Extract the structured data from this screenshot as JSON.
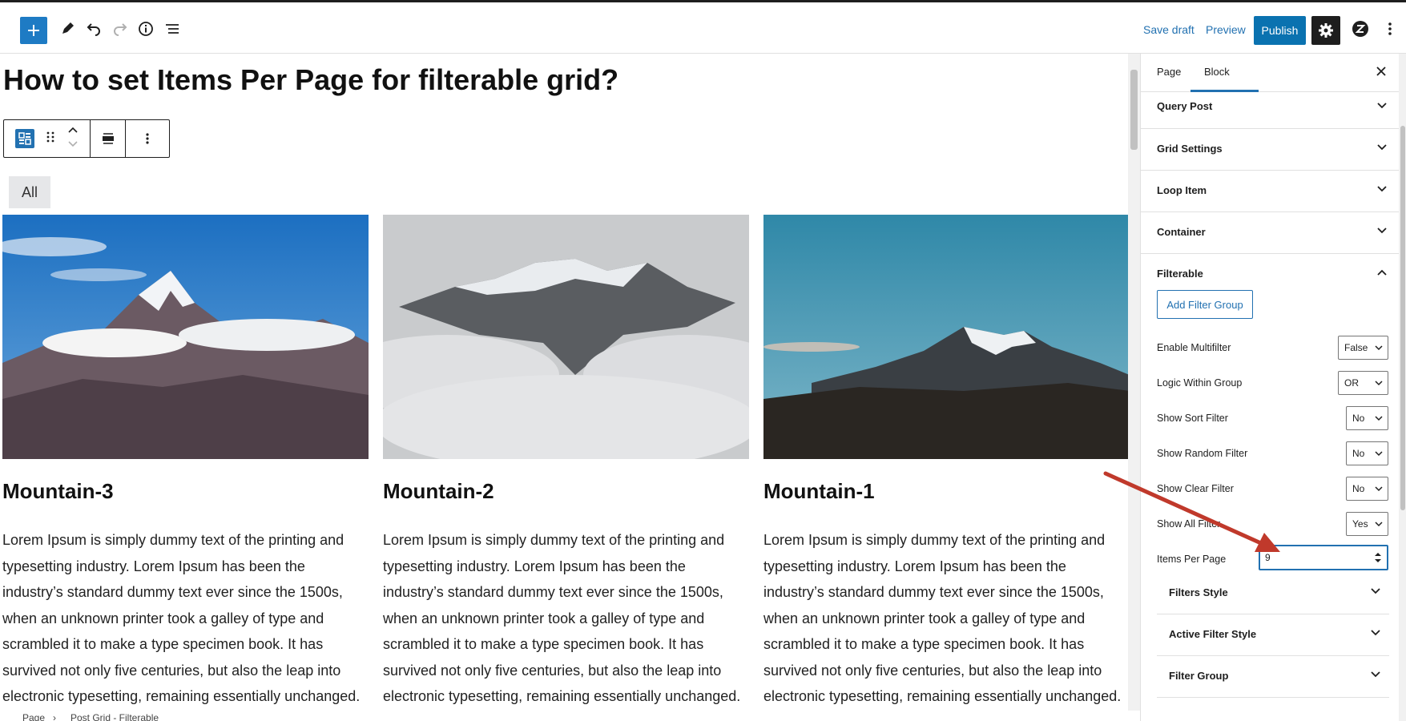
{
  "toolbar": {
    "save_draft": "Save draft",
    "preview": "Preview",
    "publish": "Publish"
  },
  "editor": {
    "title": "How to set Items Per Page for filterable grid?",
    "filter_all": "All",
    "posts": [
      {
        "title": "Mountain-3",
        "excerpt": "Lorem Ipsum is simply dummy text of the printing and typesetting industry. Lorem Ipsum has been the industry’s standard dummy text ever since the 1500s, when an unknown printer took a galley of type and scrambled it to make a type specimen book. It has survived not only five centuries, but also the leap into electronic typesetting, remaining essentially unchanged."
      },
      {
        "title": "Mountain-2",
        "excerpt": "Lorem Ipsum is simply dummy text of the printing and typesetting industry. Lorem Ipsum has been the industry’s standard dummy text ever since the 1500s, when an unknown printer took a galley of type and scrambled it to make a type specimen book. It has survived not only five centuries, but also the leap into electronic typesetting, remaining essentially unchanged."
      },
      {
        "title": "Mountain-1",
        "excerpt": "Lorem Ipsum is simply dummy text of the printing and typesetting industry. Lorem Ipsum has been the industry’s standard dummy text ever since the 1500s, when an unknown printer took a galley of type and scrambled it to make a type specimen book. It has survived not only five centuries, but also the leap into electronic typesetting, remaining essentially unchanged."
      }
    ]
  },
  "breadcrumb": {
    "root": "Page",
    "separator": "›",
    "current": "Post Grid - Filterable"
  },
  "sidebar": {
    "tabs": [
      "Page",
      "Block"
    ],
    "panels": [
      "Query Post",
      "Grid Settings",
      "Loop Item",
      "Container",
      "Filterable"
    ],
    "filterable": {
      "add_filter_group": "Add Filter Group",
      "settings": [
        {
          "label": "Enable Multifilter",
          "value": "False"
        },
        {
          "label": "Logic Within Group",
          "value": "OR"
        },
        {
          "label": "Show Sort Filter",
          "value": "No"
        },
        {
          "label": "Show Random Filter",
          "value": "No"
        },
        {
          "label": "Show Clear Filter",
          "value": "No"
        },
        {
          "label": "Show All Filter",
          "value": "Yes"
        }
      ],
      "items_per_page": {
        "label": "Items Per Page",
        "value": "9"
      },
      "subpanels": [
        "Filters Style",
        "Active Filter Style",
        "Filter Group"
      ]
    }
  },
  "colors": {
    "accent": "#2271b1",
    "publish_bg": "#0a72b0",
    "annotation_arrow": "#c0392b"
  }
}
